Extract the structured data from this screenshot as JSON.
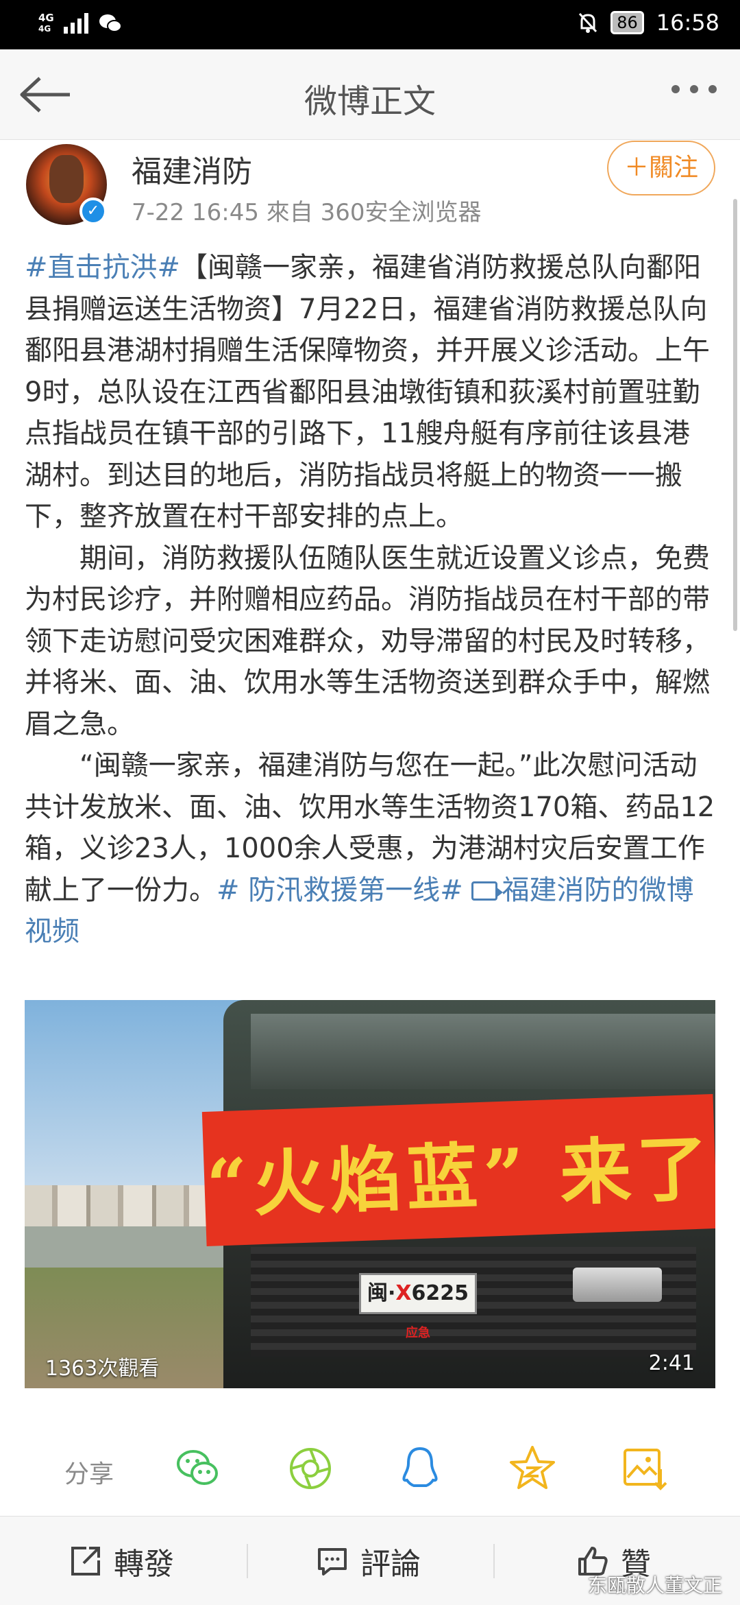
{
  "status_bar": {
    "network": "4G",
    "network_sub": "4G",
    "battery": "86",
    "time": "16:58"
  },
  "header": {
    "title": "微博正文"
  },
  "post": {
    "author": "福建消防",
    "meta": "7-22 16:45   來自 360安全浏览器",
    "follow_label": "＋關注",
    "paragraph1": {
      "topic": "#直击抗洪#",
      "text": "【闽赣一家亲，福建省消防救援总队向鄱阳县捐赠运送生活物资】7月22日，福建省消防救援总队向鄱阳县港湖村捐赠生活保障物资，并开展义诊活动。上午9时，总队设在江西省鄱阳县油墩街镇和荻溪村前置驻勤点指战员在镇干部的引路下，11艘舟艇有序前往该县港湖村。到达目的地后，消防指战员将艇上的物资一一搬下，整齐放置在村干部安排的点上。"
    },
    "paragraph2": "期间，消防救援队伍随队医生就近设置义诊点，免费为村民诊疗，并附赠相应药品。消防指战员在村干部的带领下走访慰问受灾困难群众，劝导滞留的村民及时转移，并将米、面、油、饮用水等生活物资送到群众手中，解燃眉之急。",
    "paragraph3": {
      "text": "“闽赣一家亲，福建消防与您在一起。”此次慰问活动共计发放米、面、油、饮用水等生活物资170箱、药品12箱，义诊23人，1000余人受惠，为港湖村灾后安置工作献上了一份力。",
      "topic": "# 防汛救援第一线#",
      "video_link": "福建消防的微博视频"
    }
  },
  "video": {
    "banner_text": "“火焰蓝” 来了",
    "plate_prefix": "闽·",
    "plate_letter": "X",
    "plate_number": "6225",
    "plate_suffix": "应急",
    "views": "1363次觀看",
    "duration": "2:41"
  },
  "share": {
    "label": "分享",
    "icons": [
      "wechat-icon",
      "moments-icon",
      "qq-icon",
      "qzone-icon",
      "save-image-icon"
    ]
  },
  "bottom_bar": {
    "repost": "轉發",
    "comment": "評論",
    "like": "贊"
  },
  "watermark": "东瓯散人董文正",
  "colors": {
    "topic_link": "#4a7fb5",
    "follow_orange": "#f08a24",
    "share_green": "#47c05f",
    "share_blue": "#2b8be0",
    "share_gold": "#f2b51d"
  }
}
